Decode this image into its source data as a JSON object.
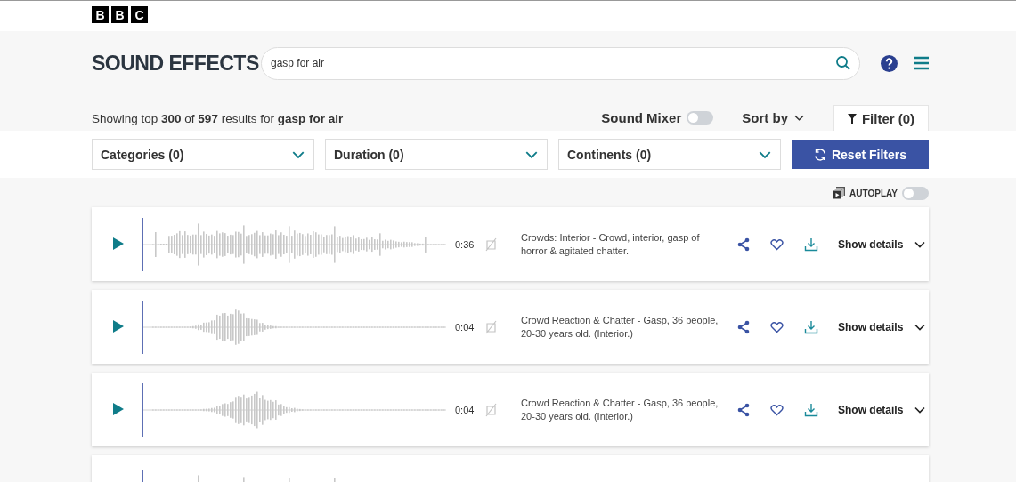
{
  "logo": [
    "B",
    "B",
    "C"
  ],
  "header": {
    "title": "SOUND EFFECTS",
    "search": {
      "value": "gasp for air"
    }
  },
  "results_summary": "Showing top **300** of **597** results for **gasp for air**",
  "sound_mixer": {
    "label": "Sound Mixer",
    "on": false
  },
  "sort": {
    "label": "Sort by"
  },
  "filter_tab": {
    "label": "Filter (0)",
    "selected": true
  },
  "filters": [
    {
      "label": "Categories (0)"
    },
    {
      "label": "Duration (0)"
    },
    {
      "label": "Continents (0)"
    }
  ],
  "reset_button": "Reset Filters",
  "autoplay": {
    "label": "AUTOPLAY",
    "on": false
  },
  "results": [
    {
      "kind": "full",
      "duration": "0:36",
      "description": "Crowds: Interior - Crowd, interior, gasp of horror & agitated chatter.",
      "details_label": "Show details"
    },
    {
      "kind": "full",
      "duration": "0:04",
      "description": "Crowd Reaction & Chatter - Gasp, 36 people, 20-30 years old. (Interior.)",
      "details_label": "Show details"
    },
    {
      "kind": "full",
      "duration": "0:04",
      "description": "Crowd Reaction & Chatter - Gasp, 36 people, 20-30 years old. (Interior.)",
      "details_label": "Show details"
    },
    {
      "kind": "partial"
    }
  ]
}
